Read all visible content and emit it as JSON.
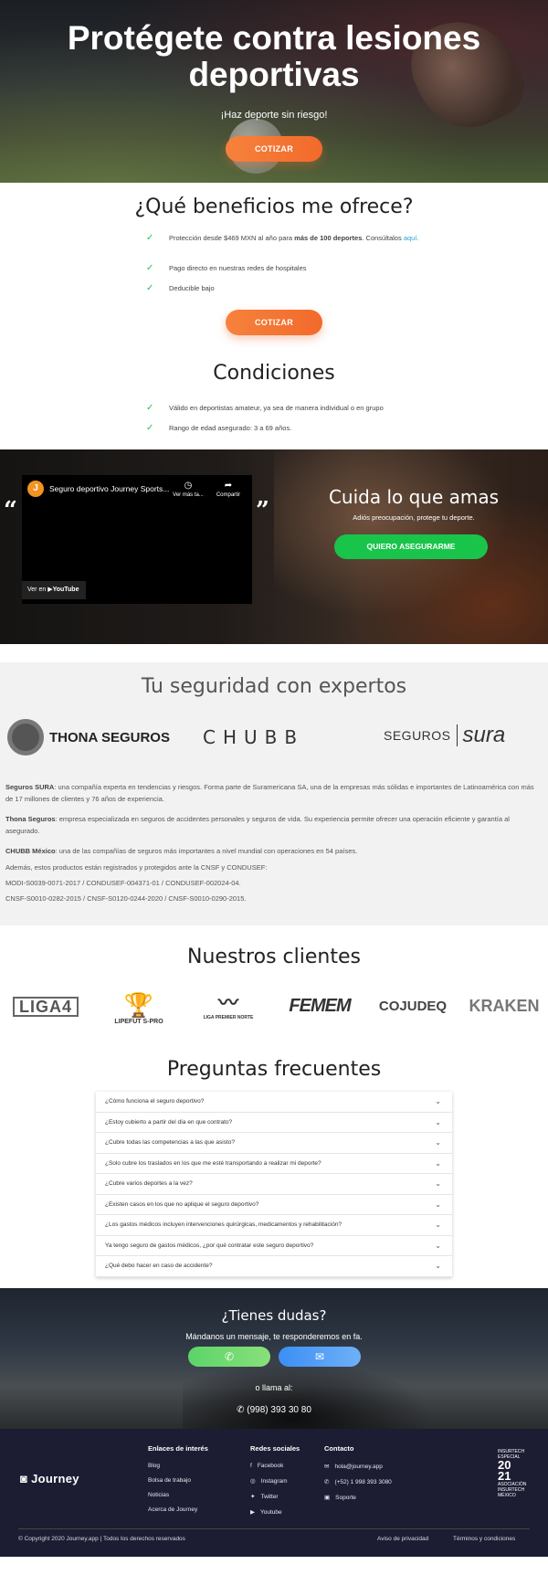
{
  "hero": {
    "title_line1": "Protégete contra lesiones",
    "title_line2": "deportivas",
    "subtitle": "¡Haz deporte sin riesgo!",
    "cta_label": "COTIZAR"
  },
  "benefits": {
    "title": "¿Qué beneficios me ofrece?",
    "items": [
      {
        "pre": "Protección desde $469 MXN al año para ",
        "bold": "más de 100 deportes",
        "post": ". Consúltalos ",
        "link": "aquí."
      },
      {
        "text": "Pago directo en nuestras redes de hospitales"
      },
      {
        "text": "Deducible bajo"
      }
    ],
    "cta_label": "COTIZAR"
  },
  "conditions": {
    "title": "Condiciones",
    "items": [
      "Válido en deportistas amateur, ya sea de manera individual o en grupo",
      "Rango de edad asegurado: 3 a 69 años."
    ]
  },
  "video_band": {
    "open_quote": "“",
    "close_quote": "”",
    "video": {
      "channel_initial": "J",
      "title": "Seguro deportivo Journey Sports...",
      "watch_later": "Ver más ta...",
      "share": "Compartir",
      "watch_on": "Ver en",
      "youtube": "YouTube"
    },
    "title": "Cuida lo que amas",
    "subtitle": "Adiós preocupación, protege tu deporte.",
    "cta_label": "QUIERO ASEGURARME"
  },
  "experts": {
    "title": "Tu seguridad con expertos",
    "logos": {
      "thona": "THONA SEGUROS",
      "chubb": "CHUBB",
      "sura_a": "SEGUROS",
      "sura_b": "sura"
    },
    "paragraphs": [
      {
        "bold": "Seguros SURA",
        "text": ": una compañía experta en tendencias y riesgos. Forma parte de Suramericana SA, una de la empresas más sólidas e importantes de Latinoamérica con más de 17 millones de clientes y 76 años de experiencia."
      },
      {
        "bold": "Thona Seguros",
        "text": ": empresa especializada en seguros de accidentes personales y seguros de vida. Su experiencia permite ofrecer una operación eficiente y garantía al asegurado."
      },
      {
        "bold": "CHUBB México",
        "text": ": una de las compañías de seguros más importantes a nivel mundial con operaciones en 54 países."
      },
      {
        "bold": "",
        "text": "Además, estos productos están registrados y protegidos ante la CNSF y CONDUSEF:"
      },
      {
        "bold": "",
        "text": "MODI-S0039-0071-2017 / CONDUSEF-004371-01 / CONDUSEF-002024-04."
      },
      {
        "bold": "",
        "text": "CNSF-S0010-0282-2015 / CNSF-S0120-0244-2020 / CNSF-S0010-0290-2015."
      }
    ]
  },
  "clients": {
    "title": "Nuestros clientes",
    "logos": [
      "LIGA4",
      "LIPEFUT S-PRO",
      "LIGA PREMIER NORTE",
      "FEMEM",
      "COJUDEQ",
      "KRAKEN"
    ]
  },
  "faq": {
    "title": "Preguntas frecuentes",
    "items": [
      "¿Cómo funciona el seguro deportivo?",
      "¿Estoy cubierto a partir del día en que contrato?",
      "¿Cubre todas las competencias a las que asisto?",
      "¿Solo cubre los traslados en los que me esté transportando a realizar mi deporte?",
      "¿Cubre varios deportes a la vez?",
      "¿Existen casos en los que no aplique el seguro deportivo?",
      "¿Los gastos médicos incluyen intervenciones quirúrgicas, medicamentos y rehabilitación?",
      "Ya tengo seguro de gastos médicos, ¿por qué contratar este seguro deportivo?",
      "¿Qué debo hacer en caso de accidente?"
    ]
  },
  "contact": {
    "title": "¿Tienes dudas?",
    "subtitle": "Mándanos un mensaje, te responderemos en fa.",
    "or_call": "o llama al:",
    "phone": "(998) 393 30 80",
    "colors": {
      "whatsapp": "#5bd46a",
      "messenger": "#3b8ff5"
    }
  },
  "footer": {
    "brand": "Journey",
    "links": {
      "heading": "Enlaces de interés",
      "items": [
        "Blog",
        "Bolsa de trabajo",
        "Noticias",
        "Acerca de Journey"
      ]
    },
    "social": {
      "heading": "Redes sociales",
      "items": [
        "Facebook",
        "Instagram",
        "Twitter",
        "Youtube"
      ]
    },
    "contact": {
      "heading": "Contacto",
      "items": [
        "hola@journey.app",
        "(+52) 1 998 393 3080",
        "Soporte"
      ]
    },
    "badge": {
      "top": "INSURTECH ESPECIAL",
      "year_a": "20",
      "year_b": "21",
      "bottom": "ASOCIACIÓN INSURTECH MÉXICO"
    },
    "copyright": "© Copyright 2020 Journey.app | Todos los derechos reservados",
    "privacy": "Aviso de privacidad",
    "terms": "Términos y condiciones"
  },
  "colors": {
    "orange": "#f26a2b",
    "green": "#19c44a",
    "check": "#2bbf4a",
    "footer_bg": "#1c1d33"
  }
}
